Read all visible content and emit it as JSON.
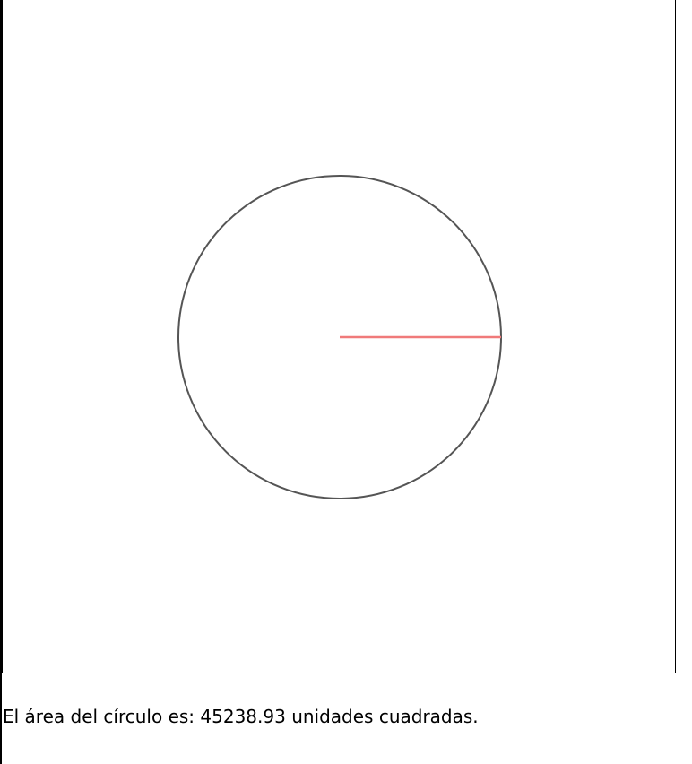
{
  "circle": {
    "radius": 120,
    "stroke_color": "#555555",
    "radius_line_color": "#f07a7a"
  },
  "result": {
    "text": "El área del círculo es: 45238.93 unidades cuadradas."
  }
}
